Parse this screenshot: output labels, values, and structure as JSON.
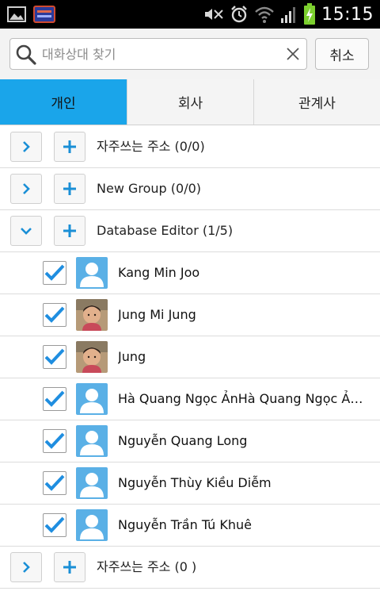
{
  "status_bar": {
    "time": "15:15",
    "icons": [
      "image-notification-icon",
      "app-notification-icon",
      "mute-icon",
      "alarm-icon",
      "wifi-icon",
      "signal-icon",
      "battery-charging-icon"
    ]
  },
  "search": {
    "placeholder": "대화상대 찾기",
    "value": "",
    "cancel_label": "취소"
  },
  "tabs": [
    {
      "label": "개인",
      "active": true
    },
    {
      "label": "회사",
      "active": false
    },
    {
      "label": "관계사",
      "active": false
    }
  ],
  "groups": [
    {
      "label": "자주쓰는 주소 (0/0)",
      "expanded": false
    },
    {
      "label": "New Group (0/0)",
      "expanded": false
    },
    {
      "label": "Database Editor (1/5)",
      "expanded": true
    },
    {
      "label": "자주쓰는 주소 (0  )",
      "expanded": false
    }
  ],
  "members": [
    {
      "name": "Kang Min Joo",
      "checked": true,
      "avatar": "default"
    },
    {
      "name": "Jung Mi Jung",
      "checked": true,
      "avatar": "photo"
    },
    {
      "name": "Jung",
      "checked": true,
      "avatar": "photo"
    },
    {
      "name": "Hà Quang Ngọc ẢnHà Quang Ngọc Ản...",
      "checked": true,
      "avatar": "default"
    },
    {
      "name": "Nguyễn Quang Long",
      "checked": true,
      "avatar": "default"
    },
    {
      "name": "Nguyễn Thùy Kiều Diễm",
      "checked": true,
      "avatar": "default"
    },
    {
      "name": "Nguyễn Trần Tú Khuê",
      "checked": true,
      "avatar": "default"
    }
  ],
  "colors": {
    "accent_blue": "#1aa5ea",
    "icon_blue": "#1a8fd6",
    "check_blue": "#1f8ee0",
    "avatar_bg": "#5ab0e6"
  }
}
